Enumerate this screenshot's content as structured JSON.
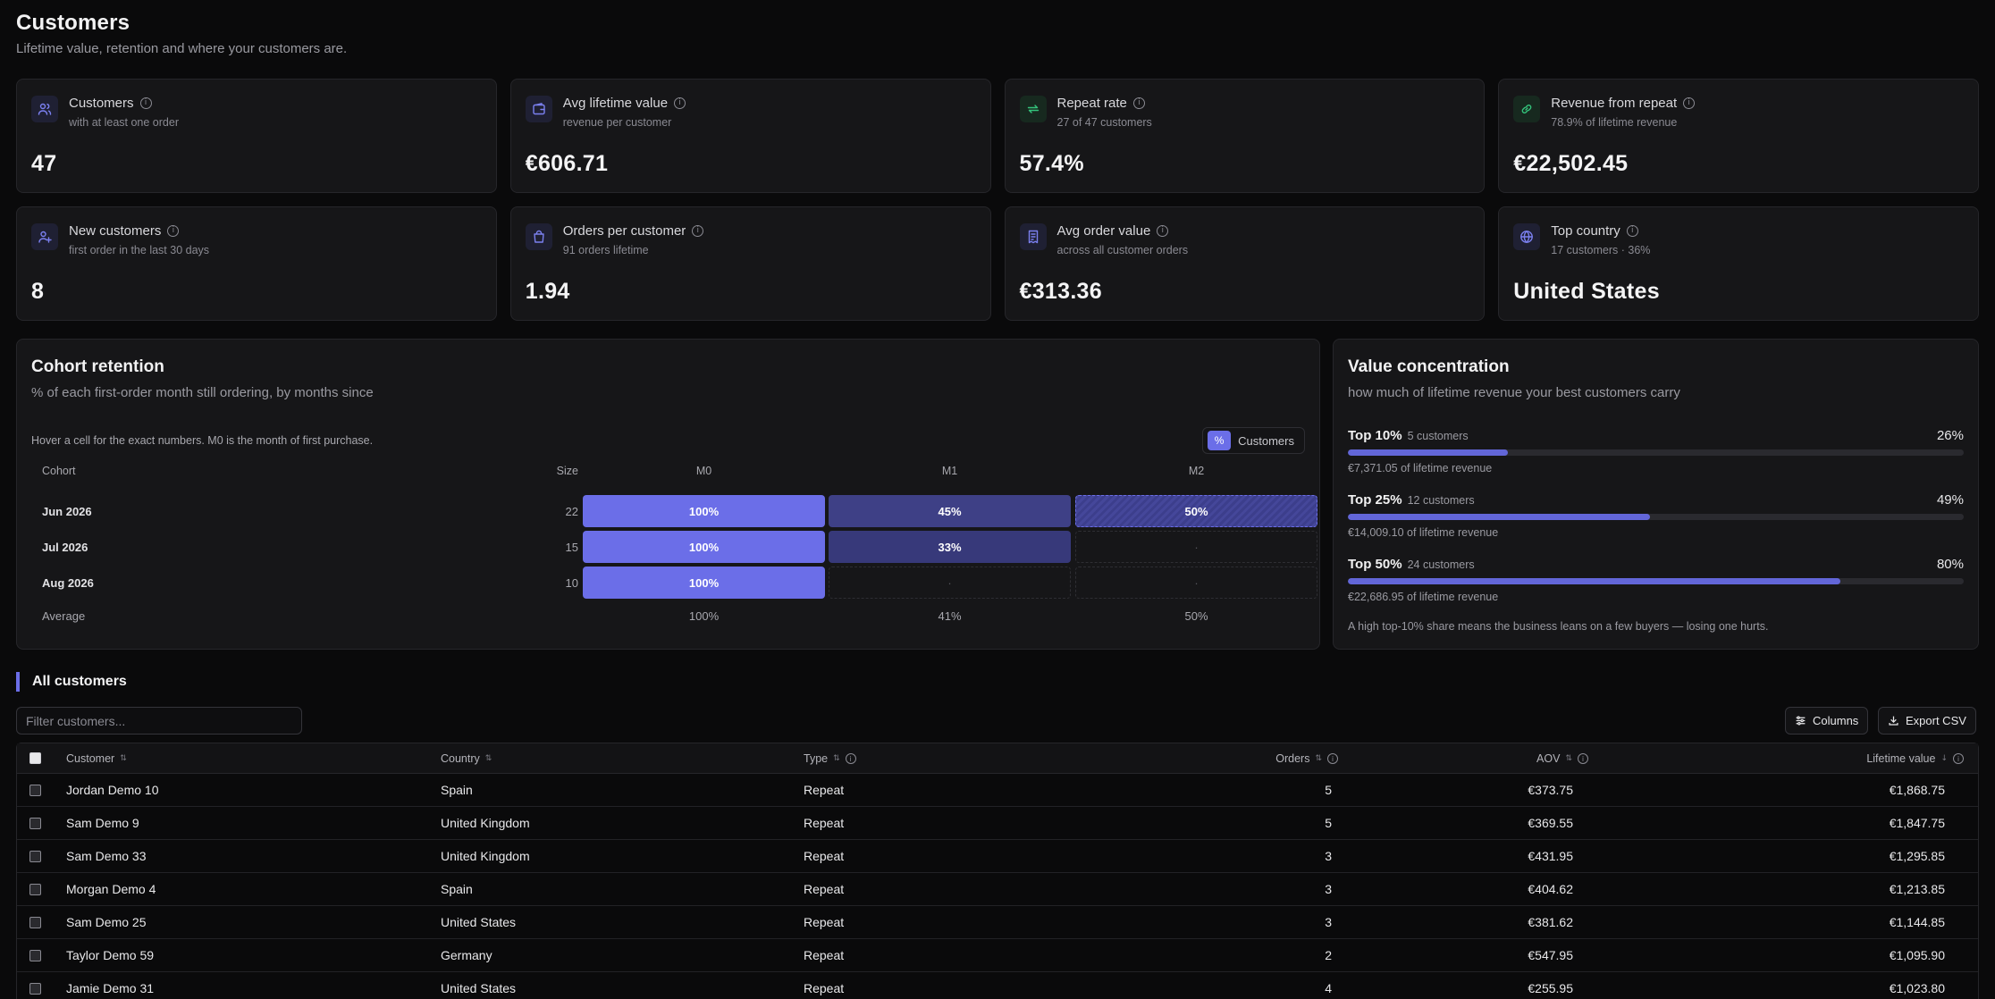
{
  "header": {
    "title": "Customers",
    "subtitle": "Lifetime value, retention and where your customers are."
  },
  "stats": [
    {
      "label": "Customers",
      "sub": "with at least one order",
      "value": "47",
      "icon": "users-icon",
      "tone": "blue"
    },
    {
      "label": "Avg lifetime value",
      "sub": "revenue per customer",
      "value": "€606.71",
      "icon": "wallet-icon",
      "tone": "blue"
    },
    {
      "label": "Repeat rate",
      "sub": "27 of 47 customers",
      "value": "57.4%",
      "icon": "repeat-icon",
      "tone": "green"
    },
    {
      "label": "Revenue from repeat",
      "sub": "78.9% of lifetime revenue",
      "value": "€22,502.45",
      "icon": "link-icon",
      "tone": "green"
    },
    {
      "label": "New customers",
      "sub": "first order in the last 30 days",
      "value": "8",
      "icon": "user-plus-icon",
      "tone": "blue"
    },
    {
      "label": "Orders per customer",
      "sub": "91 orders lifetime",
      "value": "1.94",
      "icon": "shopping-bag-icon",
      "tone": "blue"
    },
    {
      "label": "Avg order value",
      "sub": "across all customer orders",
      "value": "€313.36",
      "icon": "receipt-icon",
      "tone": "blue"
    },
    {
      "label": "Top country",
      "sub": "17 customers · 36%",
      "value": "United States",
      "icon": "globe-icon",
      "tone": "blue"
    }
  ],
  "cohort": {
    "title": "Cohort retention",
    "subtitle": "% of each first-order month still ordering, by months since",
    "hint": "Hover a cell for the exact numbers. M0 is the month of first purchase.",
    "toggle": {
      "percent_label": "%",
      "customers_label": "Customers"
    },
    "columns": {
      "cohort": "Cohort",
      "size": "Size",
      "months": [
        "M0",
        "M1",
        "M2"
      ]
    },
    "rows": [
      {
        "label": "Jun 2026",
        "size": "22",
        "cells": [
          {
            "text": "100%",
            "value": 100
          },
          {
            "text": "45%",
            "value": 45
          },
          {
            "text": "50%",
            "value": 50,
            "partial": true
          }
        ]
      },
      {
        "label": "Jul 2026",
        "size": "15",
        "cells": [
          {
            "text": "100%",
            "value": 100
          },
          {
            "text": "33%",
            "value": 33
          },
          {
            "text": "·",
            "value": null
          }
        ]
      },
      {
        "label": "Aug 2026",
        "size": "10",
        "cells": [
          {
            "text": "100%",
            "value": 100
          },
          {
            "text": "·",
            "value": null
          },
          {
            "text": "·",
            "value": null
          }
        ]
      }
    ],
    "average": {
      "label": "Average",
      "values": [
        "100%",
        "41%",
        "50%"
      ]
    },
    "colors": {
      "full": "#6b6ee8",
      "mid": "#3e4086",
      "low": "#37397a"
    }
  },
  "concentration": {
    "title": "Value concentration",
    "subtitle": "how much of lifetime revenue your best customers carry",
    "rows": [
      {
        "label": "Top 10%",
        "count": "5 customers",
        "pct_text": "26%",
        "pct": 26,
        "revenue": "€7,371.05 of lifetime revenue"
      },
      {
        "label": "Top 25%",
        "count": "12 customers",
        "pct_text": "49%",
        "pct": 49,
        "revenue": "€14,009.10 of lifetime revenue"
      },
      {
        "label": "Top 50%",
        "count": "24 customers",
        "pct_text": "80%",
        "pct": 80,
        "revenue": "€22,686.95 of lifetime revenue"
      }
    ],
    "note": "A high top-10% share means the business leans on a few buyers — losing one hurts."
  },
  "customers": {
    "section_title": "All customers",
    "filter_placeholder": "Filter customers...",
    "columns_button": "Columns",
    "export_button": "Export CSV",
    "headers": {
      "customer": "Customer",
      "country": "Country",
      "type": "Type",
      "orders": "Orders",
      "aov": "AOV",
      "ltv": "Lifetime value"
    },
    "rows": [
      {
        "name": "Jordan Demo 10",
        "country": "Spain",
        "type": "Repeat",
        "orders": "5",
        "aov": "€373.75",
        "ltv": "€1,868.75"
      },
      {
        "name": "Sam Demo 9",
        "country": "United Kingdom",
        "type": "Repeat",
        "orders": "5",
        "aov": "€369.55",
        "ltv": "€1,847.75"
      },
      {
        "name": "Sam Demo 33",
        "country": "United Kingdom",
        "type": "Repeat",
        "orders": "3",
        "aov": "€431.95",
        "ltv": "€1,295.85"
      },
      {
        "name": "Morgan Demo 4",
        "country": "Spain",
        "type": "Repeat",
        "orders": "3",
        "aov": "€404.62",
        "ltv": "€1,213.85"
      },
      {
        "name": "Sam Demo 25",
        "country": "United States",
        "type": "Repeat",
        "orders": "3",
        "aov": "€381.62",
        "ltv": "€1,144.85"
      },
      {
        "name": "Taylor Demo 59",
        "country": "Germany",
        "type": "Repeat",
        "orders": "2",
        "aov": "€547.95",
        "ltv": "€1,095.90"
      },
      {
        "name": "Jamie Demo 31",
        "country": "United States",
        "type": "Repeat",
        "orders": "4",
        "aov": "€255.95",
        "ltv": "€1,023.80"
      }
    ]
  }
}
